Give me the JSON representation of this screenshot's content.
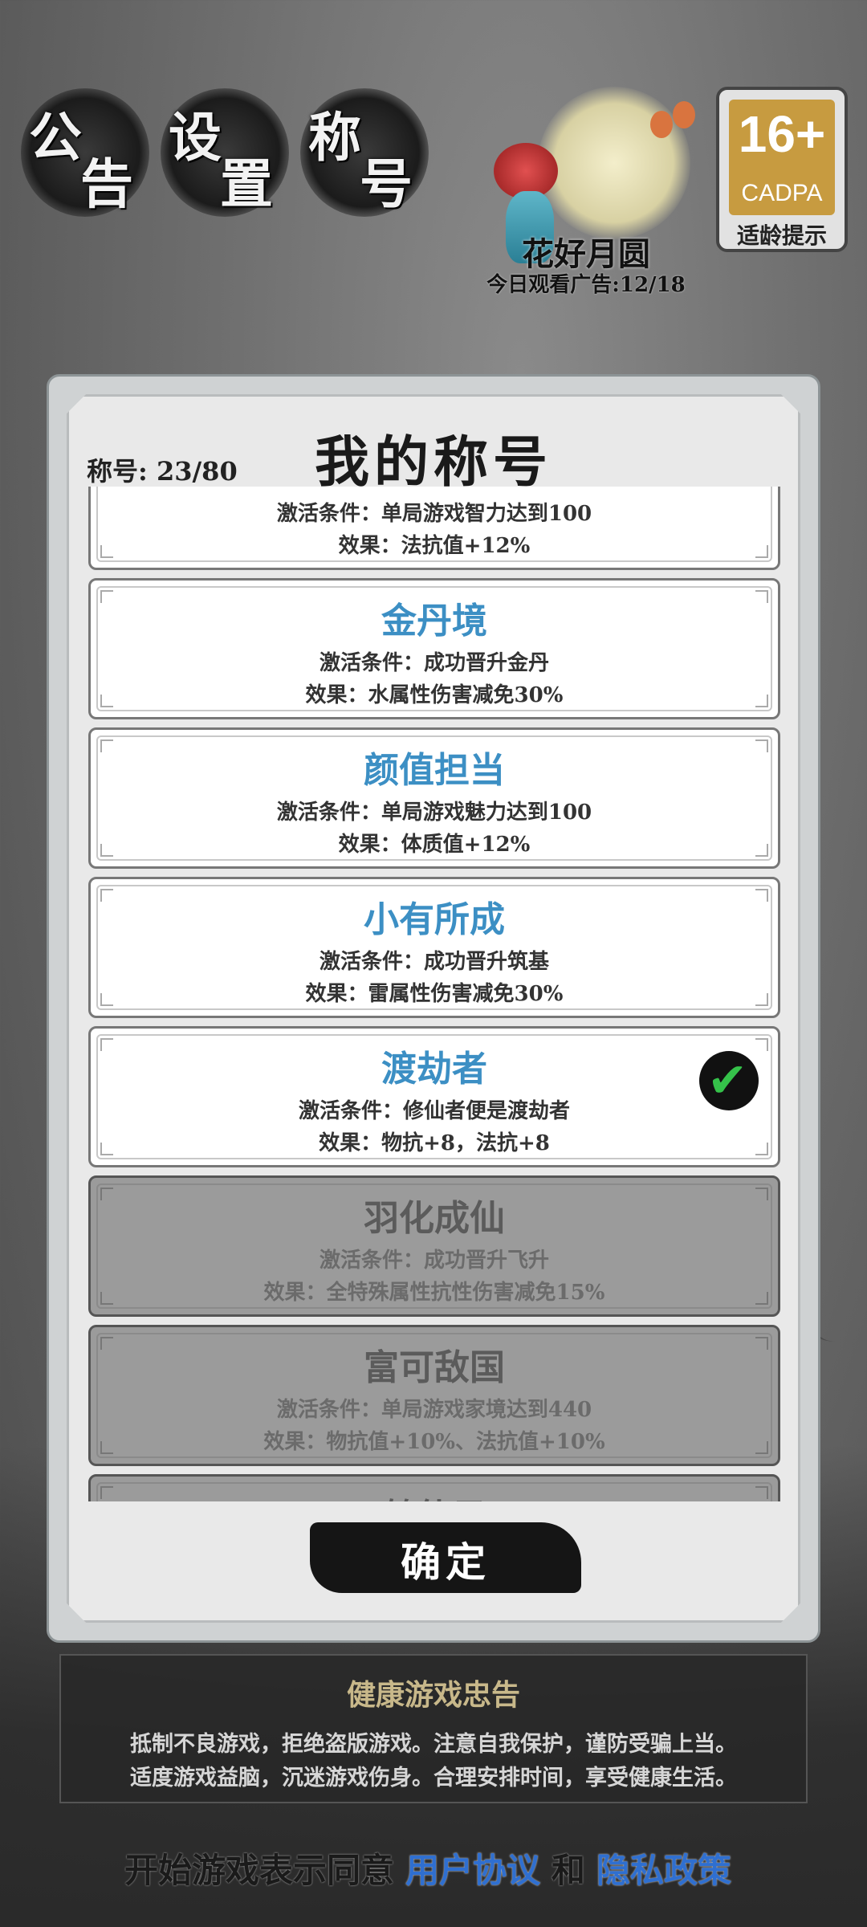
{
  "top_buttons": [
    {
      "c1": "公",
      "c2": "告"
    },
    {
      "c1": "设",
      "c2": "置"
    },
    {
      "c1": "称",
      "c2": "号"
    }
  ],
  "event": {
    "title": "花好月圆",
    "subtitle": "今日观看广告:12/18"
  },
  "age_badge": {
    "number": "16+",
    "org": "CADPA",
    "label": "适龄提示"
  },
  "dialog": {
    "title": "我的称号",
    "count": "称号: 23/80",
    "confirm_label": "确定",
    "cards": [
      {
        "name": "",
        "condition": "激活条件：单局游戏智力达到100",
        "effect": "效果：法抗值+12%",
        "state": "unlocked"
      },
      {
        "name": "金丹境",
        "condition": "激活条件：成功晋升金丹",
        "effect": "效果：水属性伤害减免30%",
        "state": "unlocked"
      },
      {
        "name": "颜值担当",
        "condition": "激活条件：单局游戏魅力达到100",
        "effect": "效果：体质值+12%",
        "state": "unlocked"
      },
      {
        "name": "小有所成",
        "condition": "激活条件：成功晋升筑基",
        "effect": "效果：雷属性伤害减免30%",
        "state": "unlocked"
      },
      {
        "name": "渡劫者",
        "condition": "激活条件：修仙者便是渡劫者",
        "effect": "效果：物抗+8，法抗+8",
        "state": "equipped"
      },
      {
        "name": "羽化成仙",
        "condition": "激活条件：成功晋升飞升",
        "effect": "效果：全特殊属性抗性伤害减免15%",
        "state": "locked"
      },
      {
        "name": "富可敌国",
        "condition": "激活条件：单局游戏家境达到440",
        "effect": "效果：物抗值+10%、法抗值+10%",
        "state": "locked"
      },
      {
        "name": "鹤仙子",
        "condition": "",
        "effect": "",
        "state": "locked"
      }
    ]
  },
  "notice": {
    "title": "健康游戏忠告",
    "line1": "抵制不良游戏，拒绝盗版游戏。注意自我保护，谨防受骗上当。",
    "line2": "适度游戏益脑，沉迷游戏伤身。合理安排时间，享受健康生活。"
  },
  "agreement": {
    "prefix": "开始游戏表示同意",
    "user_link": "用户协议",
    "and": "和",
    "privacy_link": "隐私政策"
  },
  "colors": {
    "unlocked_name": "#3c8fc4",
    "locked_card": "#9b9b9b",
    "check": "#35c24a",
    "link": "#2f6fd0"
  }
}
